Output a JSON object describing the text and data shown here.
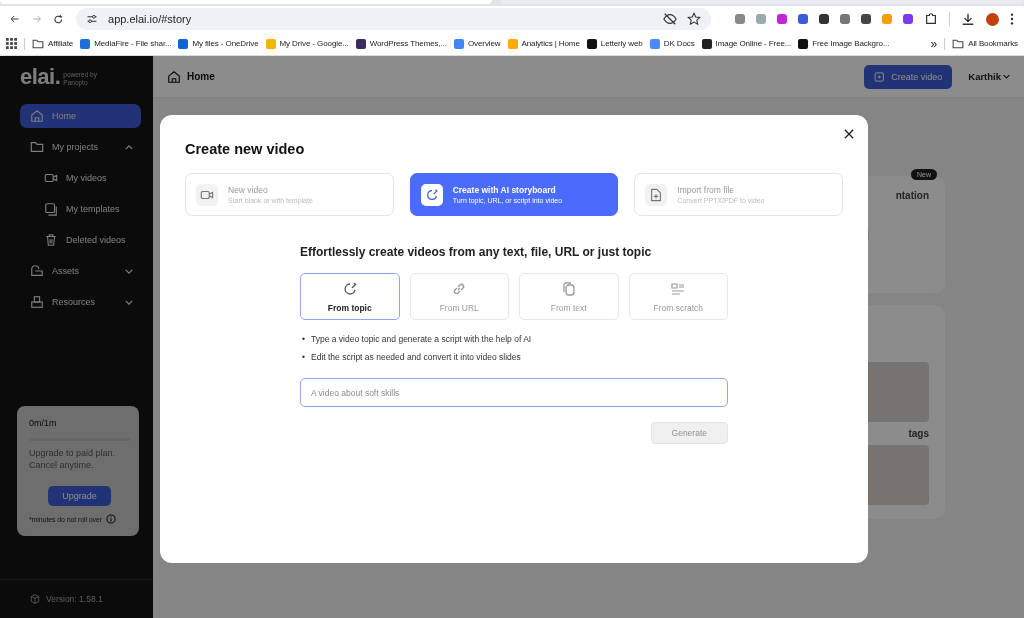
{
  "browser": {
    "url": "app.elai.io/#story",
    "bookmarks": [
      "Affiliate",
      "MediaFire - File shar...",
      "My files - OneDrive",
      "My Drive - Google...",
      "WordPress Themes,...",
      "Overview",
      "Analytics | Home",
      "Letterly web",
      "DK Docs",
      "Image Online - Free...",
      "Free Image Backgro..."
    ],
    "overflow": "»",
    "all_bookmarks": "All Bookmarks"
  },
  "sidebar": {
    "logo": "elai.",
    "logo_note": "powered by Panopto",
    "items": [
      {
        "label": "Home",
        "selected": true
      },
      {
        "label": "My projects",
        "selected": false,
        "expanded": true,
        "children": [
          {
            "label": "My videos",
            "selected": false
          },
          {
            "label": "My templates",
            "selected": false
          },
          {
            "label": "Deleted videos",
            "selected": false
          }
        ]
      },
      {
        "label": "Assets",
        "selected": false,
        "expanded": false
      },
      {
        "label": "Resources",
        "selected": false,
        "expanded": false
      }
    ],
    "usage": {
      "minutes": "0m/1m",
      "text": "Upgrade to paid plan. Cancel anytime.",
      "button": "Upgrade",
      "note": "*minutes do not roll over"
    },
    "version": "Version: 1.58.1"
  },
  "header": {
    "title": "Home",
    "create_button": "Create video",
    "user": "Karthik"
  },
  "background_cards": [
    {
      "badge": "New",
      "title": "ntation"
    },
    {
      "caption": "tags"
    }
  ],
  "modal": {
    "title": "Create new video",
    "options": [
      {
        "title": "New video",
        "subtitle": "Start blank or with template",
        "selected": false
      },
      {
        "title": "Create with AI storyboard",
        "subtitle": "Turn topic, URL, or script into video",
        "selected": true
      },
      {
        "title": "Import from file",
        "subtitle": "Convert PPTX/PDF to video",
        "selected": false
      }
    ],
    "heading": "Effortlessly create videos from any text, file, URL or just topic",
    "sources": [
      {
        "label": "From topic",
        "selected": true
      },
      {
        "label": "From URL",
        "selected": false
      },
      {
        "label": "From text",
        "selected": false
      },
      {
        "label": "From scratch",
        "selected": false
      }
    ],
    "bullets": [
      {
        "marker": "•",
        "text": "Type a video topic and generate a script with the help of AI"
      },
      {
        "marker": "•",
        "text": "Edit the script as needed and convert it into video slides"
      }
    ],
    "input": {
      "placeholder": "A video about soft skills"
    },
    "generate": {
      "label": "Generate",
      "disabled": true
    }
  }
}
